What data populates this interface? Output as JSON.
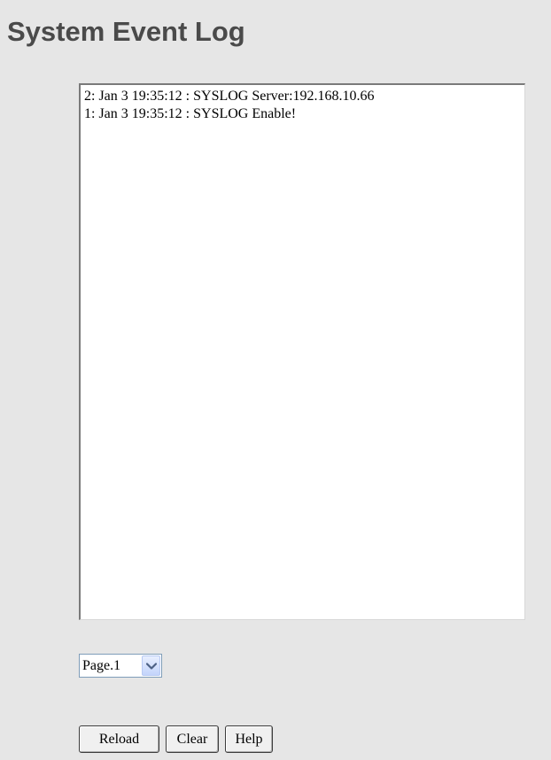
{
  "page": {
    "title": "System Event Log"
  },
  "log": {
    "entries": [
      "2: Jan 3 19:35:12 : SYSLOG Server:192.168.10.66",
      "1: Jan 3 19:35:12 : SYSLOG Enable!"
    ]
  },
  "page_select": {
    "value": "Page.1",
    "arrow_icon": "chevron-down-icon"
  },
  "buttons": {
    "reload": "Reload",
    "clear": "Clear",
    "help": "Help"
  }
}
